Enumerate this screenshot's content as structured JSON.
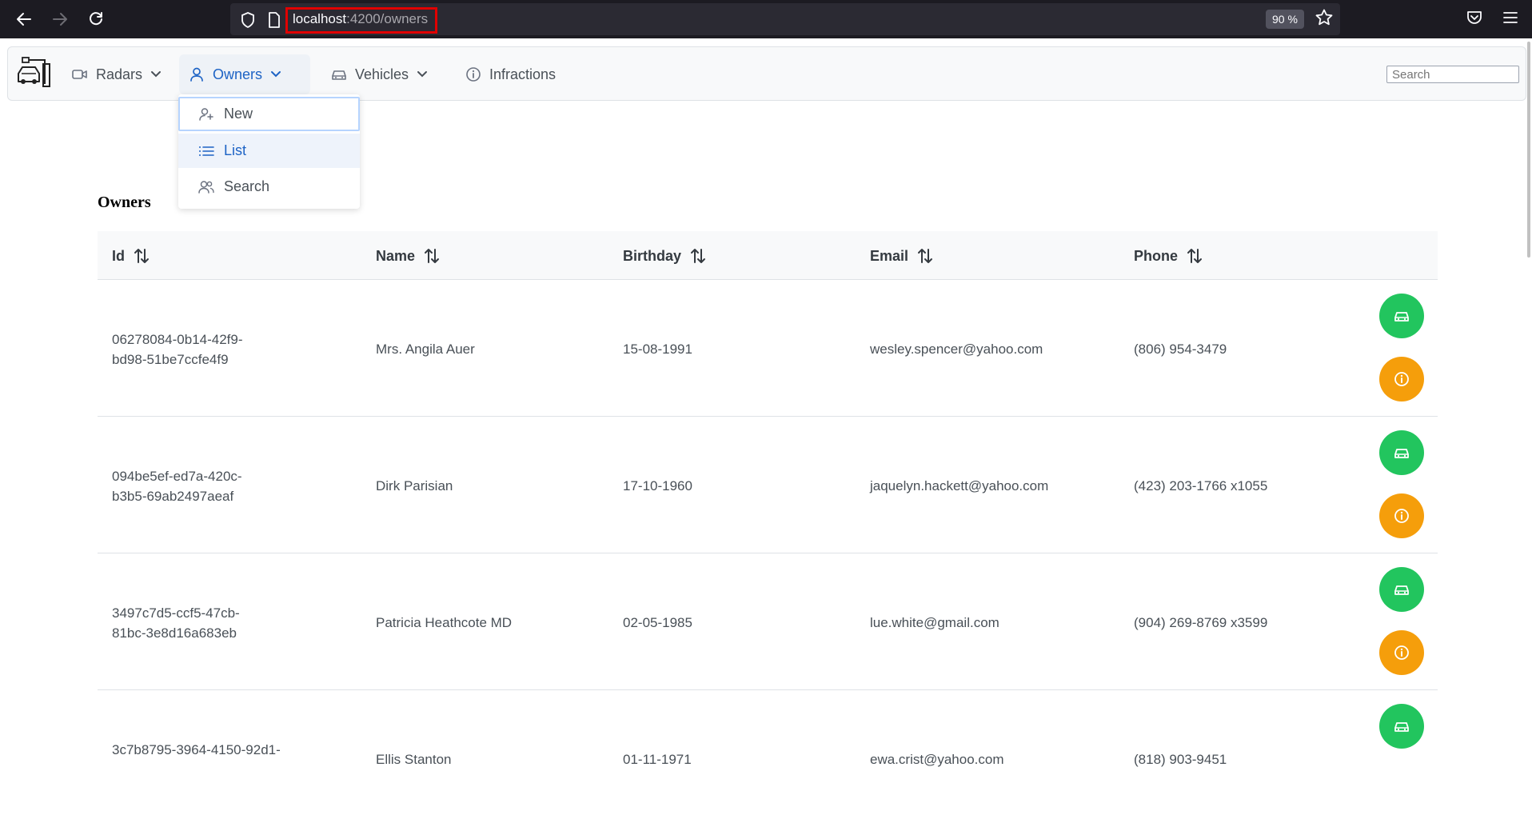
{
  "browser": {
    "url_host": "localhost",
    "url_path": ":4200/owners",
    "zoom": "90 %"
  },
  "navbar": {
    "items": [
      {
        "label": "Radars"
      },
      {
        "label": "Owners"
      },
      {
        "label": "Vehicles"
      },
      {
        "label": "Infractions"
      }
    ],
    "search_placeholder": "Search"
  },
  "dropdown": {
    "items": [
      {
        "label": "New"
      },
      {
        "label": "List"
      },
      {
        "label": "Search"
      }
    ]
  },
  "page": {
    "title": "Owners"
  },
  "table": {
    "columns": [
      "Id",
      "Name",
      "Birthday",
      "Email",
      "Phone"
    ],
    "rows": [
      {
        "id_line1": "06278084-0b14-42f9-",
        "id_line2": "bd98-51be7ccfe4f9",
        "name": "Mrs. Angila Auer",
        "birthday": "15-08-1991",
        "email": "wesley.spencer@yahoo.com",
        "phone": "(806) 954-3479"
      },
      {
        "id_line1": "094be5ef-ed7a-420c-",
        "id_line2": "b3b5-69ab2497aeaf",
        "name": "Dirk Parisian",
        "birthday": "17-10-1960",
        "email": "jaquelyn.hackett@yahoo.com",
        "phone": "(423) 203-1766 x1055"
      },
      {
        "id_line1": "3497c7d5-ccf5-47cb-",
        "id_line2": "81bc-3e8d16a683eb",
        "name": "Patricia Heathcote MD",
        "birthday": "02-05-1985",
        "email": "lue.white@gmail.com",
        "phone": "(904) 269-8769 x3599"
      },
      {
        "id_line1": "3c7b8795-3964-4150-92d1-",
        "id_line2": "",
        "name": "Ellis Stanton",
        "birthday": "01-11-1971",
        "email": "ewa.crist@yahoo.com",
        "phone": "(818) 903-9451"
      }
    ]
  },
  "colors": {
    "accent_blue": "#1d63c5",
    "vehicles_button": "#22c55e",
    "infractions_button": "#f59e0b",
    "url_outline": "#e00000"
  }
}
